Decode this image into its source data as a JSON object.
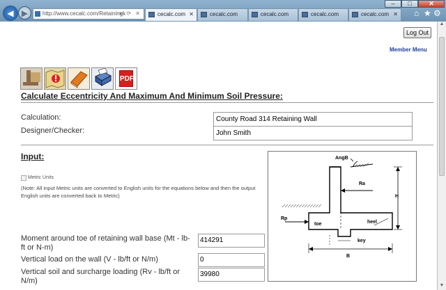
{
  "browser": {
    "address": "http://www.cecalc.com/Retainingk",
    "address_controls": "▾ ⟳ ✕",
    "tabs": [
      {
        "label": "cecalc.com"
      },
      {
        "label": "cecalc.com"
      },
      {
        "label": "cecalc.com"
      },
      {
        "label": "cecalc.com"
      },
      {
        "label": "cecalc.com"
      }
    ],
    "window_buttons": {
      "minimize": "‒",
      "maximize": "□",
      "close": "✕"
    }
  },
  "header": {
    "logout_label": "Log Out",
    "member_menu_label": "Member Menu"
  },
  "toolbar": {
    "icons": [
      "retaining-wall-icon",
      "warning-map-icon",
      "book-icon",
      "print-icon",
      "pdf-icon"
    ],
    "pdf_text": "PDF"
  },
  "page": {
    "title": "Calculate Eccentricity And Maximum And Minimum Soil Pressure:"
  },
  "fields": {
    "calculation_label": "Calculation:",
    "calculation_value": "County Road 314 Retaining Wall",
    "designer_label": "Designer/Checker:",
    "designer_value": "John Smith"
  },
  "input_section": {
    "heading": "Input:",
    "metric_label": "Metric Units",
    "note": "(Note: All input Metric units are converted to English units for the equations below and then the output English units are converted back to Metric)"
  },
  "diagram": {
    "labels": {
      "angb": "AngB",
      "ra": "Ra",
      "h": "H",
      "rp": "Rp",
      "toe": "toe",
      "heel": "heel",
      "key": "key",
      "b": "B"
    }
  },
  "params": [
    {
      "label": "Moment around toe of retaining wall base (Mt - lb-ft or N-m)",
      "value": "414291"
    },
    {
      "label": "Vertical load on the wall (V - lb/ft or N/m)",
      "value": "0"
    },
    {
      "label": "Vertical soil and surcharge loading (Rv - lb/ft or N/m)",
      "value": "39980"
    }
  ]
}
